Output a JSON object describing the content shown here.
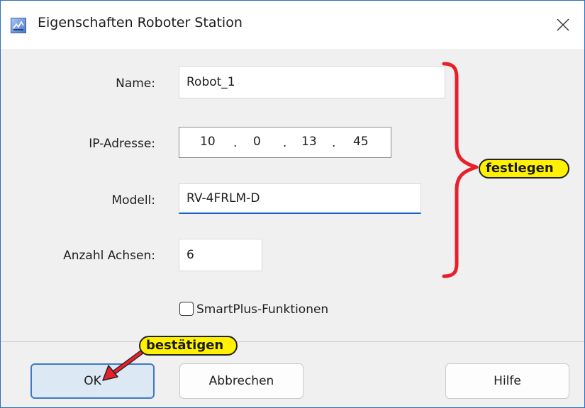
{
  "window": {
    "title": "Eigenschaften Roboter Station",
    "app_icon": "app-icon",
    "close_icon": "close-icon"
  },
  "form": {
    "name": {
      "label": "Name:",
      "value": "Robot_1"
    },
    "ip": {
      "label": "IP-Adresse:",
      "octets": [
        "10",
        "0",
        "13",
        "45"
      ],
      "separator": "."
    },
    "model": {
      "label": "Modell:",
      "value": "RV-4FRLM-D"
    },
    "axes": {
      "label": "Anzahl Achsen:",
      "value": "6"
    },
    "smartplus": {
      "label": "SmartPlus-Funktionen",
      "checked": false
    }
  },
  "buttons": {
    "ok": "OK",
    "cancel": "Abbrechen",
    "help": "Hilfe"
  },
  "annotations": {
    "brace_callout": "festlegen",
    "ok_callout": "bestätigen",
    "annotation_color": "#e8202a",
    "callout_color": "#fff100"
  },
  "colors": {
    "accent": "#3f78c6",
    "focus_underline": "#1e64c8"
  }
}
